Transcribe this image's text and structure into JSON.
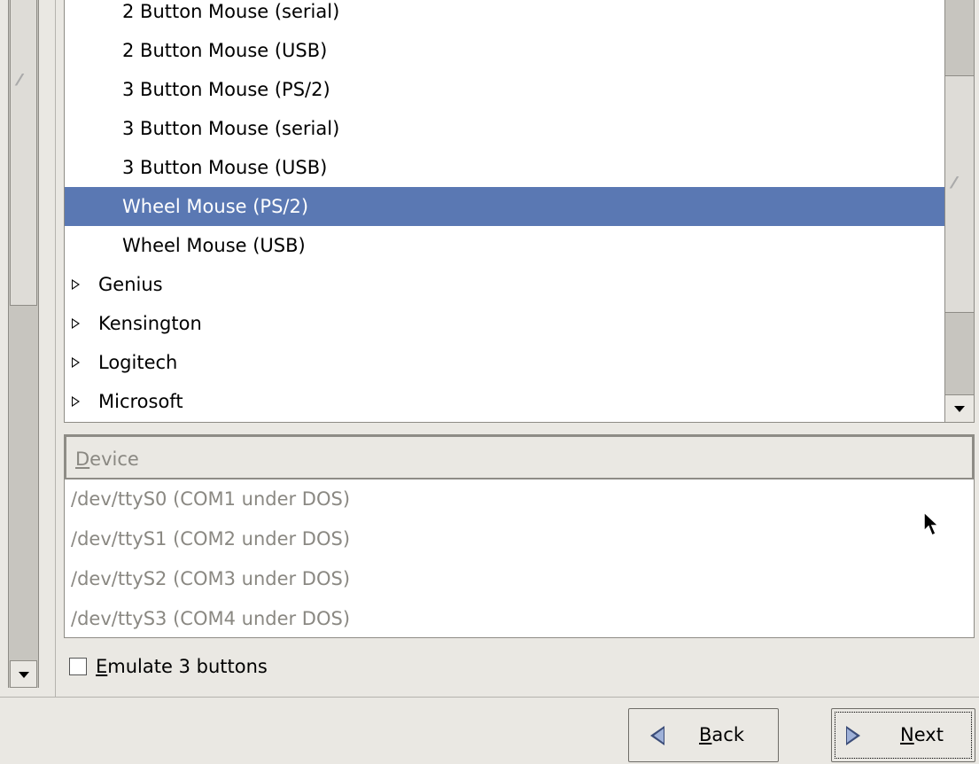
{
  "mouse_list": {
    "rows": [
      {
        "label": "2 Button Mouse (serial)",
        "level": "child"
      },
      {
        "label": "2 Button Mouse (USB)",
        "level": "child"
      },
      {
        "label": "3 Button Mouse (PS/2)",
        "level": "child"
      },
      {
        "label": "3 Button Mouse (serial)",
        "level": "child"
      },
      {
        "label": "3 Button Mouse (USB)",
        "level": "child"
      },
      {
        "label": "Wheel Mouse (PS/2)",
        "level": "child",
        "selected": true
      },
      {
        "label": "Wheel Mouse (USB)",
        "level": "child"
      },
      {
        "label": "Genius",
        "level": "parent",
        "expanded": false
      },
      {
        "label": "Kensington",
        "level": "parent",
        "expanded": false
      },
      {
        "label": "Logitech",
        "level": "parent",
        "expanded": false
      },
      {
        "label": "Microsoft",
        "level": "parent",
        "expanded": false
      }
    ]
  },
  "device_list": {
    "header": "Device",
    "header_mnemonic": "D",
    "header_rest": "evice",
    "rows": [
      "/dev/ttyS0 (COM1 under DOS)",
      "/dev/ttyS1 (COM2 under DOS)",
      "/dev/ttyS2 (COM3 under DOS)",
      "/dev/ttyS3 (COM4 under DOS)"
    ]
  },
  "emulate_checkbox": {
    "label": "Emulate 3 buttons",
    "mnemonic": "E",
    "rest": "mulate 3 buttons",
    "checked": false
  },
  "nav": {
    "back_label": "Back",
    "back_mnemonic": "B",
    "back_rest": "ack",
    "next_label": "Next",
    "next_mnemonic": "N",
    "next_rest": "ext"
  },
  "colors": {
    "selection": "#5a78b3",
    "window_bg": "#eae8e3",
    "disabled_text": "#8a8882"
  }
}
